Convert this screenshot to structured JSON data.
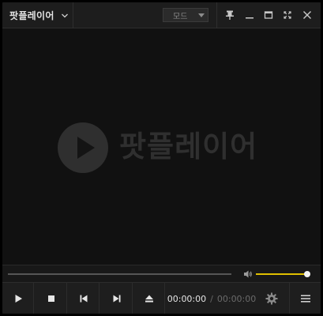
{
  "app": {
    "title": "팟플레이어",
    "mode_label": "모드"
  },
  "title_buttons": {
    "pin": "pin-icon",
    "minimize": "minimize-icon",
    "maximize": "maximize-icon",
    "fullscreen": "fullscreen-icon",
    "close": "close-icon"
  },
  "video": {
    "logo_text": "팟플레이어"
  },
  "playback": {
    "current_time": "00:00:00",
    "separator": "/",
    "total_time": "00:00:00",
    "seek_progress": 0,
    "volume_level": 0.95
  },
  "controls": {
    "buttons": [
      "play-icon",
      "stop-icon",
      "previous-icon",
      "next-icon",
      "eject-icon",
      "gear-icon",
      "menu-icon"
    ]
  },
  "colors": {
    "accent_volume": "#e0c000",
    "background": "#111111",
    "bar": "#1e1e1e"
  }
}
